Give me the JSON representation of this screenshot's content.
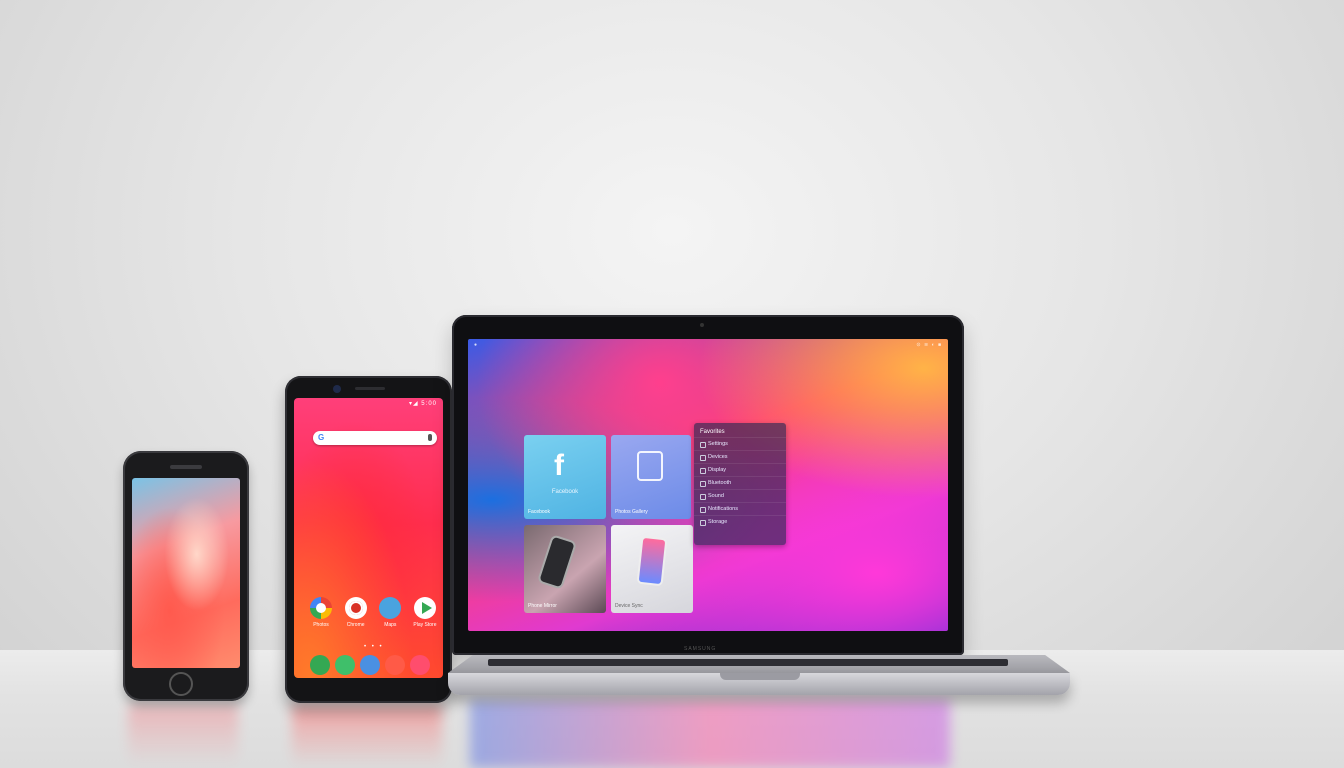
{
  "android_phone": {
    "status": "▾◢ 5:00",
    "search_g": "G",
    "apps": [
      {
        "label": "Photos",
        "icon": "photos-icon"
      },
      {
        "label": "Chrome",
        "icon": "chrome-icon"
      },
      {
        "label": "Maps",
        "icon": "maps-icon"
      },
      {
        "label": "Play Store",
        "icon": "play-store-icon"
      }
    ],
    "dock": [
      {
        "icon": "phone-icon",
        "color": "#34a853"
      },
      {
        "icon": "messages-icon",
        "color": "#3fbf6a"
      },
      {
        "icon": "contacts-icon",
        "color": "#4a90e2"
      },
      {
        "icon": "music-icon",
        "color": "#ff5a47"
      },
      {
        "icon": "camera-icon",
        "color": "#ff4d6d"
      }
    ],
    "nav": [
      "◁",
      "○",
      "□"
    ],
    "page_dots": "• • •"
  },
  "laptop": {
    "menubar_left": "●",
    "menubar_right": "⊙ ≋ ◐ ■",
    "tiles": [
      {
        "logo": "f",
        "name": "Facebook",
        "caption": "Facebook"
      },
      {
        "caption": "Photos Gallery"
      },
      {
        "caption": "Phone Mirror"
      },
      {
        "caption": "Device Sync"
      }
    ],
    "menu": {
      "header": "Favorites",
      "items": [
        "Settings",
        "Devices",
        "Display",
        "Bluetooth",
        "Sound",
        "Notifications",
        "Storage"
      ]
    },
    "brand": "SAMSUNG"
  },
  "colors": {
    "backdrop": "#e6e6e6",
    "facebook": "#4fb3e3"
  }
}
